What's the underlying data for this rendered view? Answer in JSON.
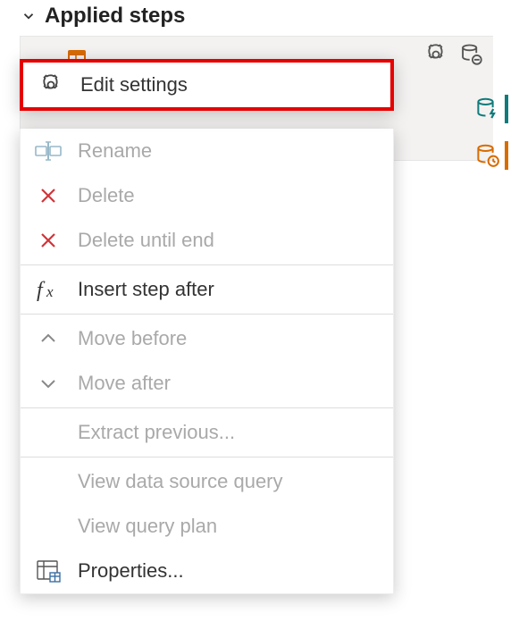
{
  "header": {
    "title": "Applied steps"
  },
  "context_menu": {
    "edit_settings": "Edit settings",
    "rename": "Rename",
    "delete": "Delete",
    "delete_until_end": "Delete until end",
    "insert_step_after": "Insert step after",
    "move_before": "Move before",
    "move_after": "Move after",
    "extract_previous": "Extract previous...",
    "view_data_source_query": "View data source query",
    "view_query_plan": "View query plan",
    "properties": "Properties..."
  },
  "colors": {
    "highlight_border": "#e60000",
    "delete_x": "#d13438",
    "teal": "#0f7b7b",
    "orange": "#d86b00"
  }
}
